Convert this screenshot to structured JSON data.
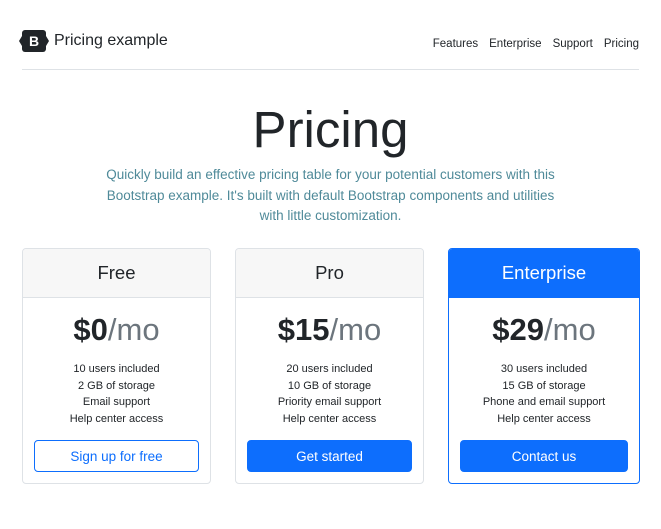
{
  "header": {
    "brand_letter": "B",
    "brand_name": "Pricing example",
    "nav": [
      "Features",
      "Enterprise",
      "Support",
      "Pricing"
    ]
  },
  "hero": {
    "title": "Pricing",
    "lead": "Quickly build an effective pricing table for your potential customers with this Bootstrap example. It's built with default Bootstrap components and utilities with little customization."
  },
  "plans": [
    {
      "name": "Free",
      "price": "$0",
      "period": "/mo",
      "features": [
        "10 users included",
        "2 GB of storage",
        "Email support",
        "Help center access"
      ],
      "button": "Sign up for free"
    },
    {
      "name": "Pro",
      "price": "$15",
      "period": "/mo",
      "features": [
        "20 users included",
        "10 GB of storage",
        "Priority email support",
        "Help center access"
      ],
      "button": "Get started"
    },
    {
      "name": "Enterprise",
      "price": "$29",
      "period": "/mo",
      "features": [
        "30 users included",
        "15 GB of storage",
        "Phone and email support",
        "Help center access"
      ],
      "button": "Contact us"
    }
  ],
  "colors": {
    "accent": "#0d6efd",
    "lead_text": "#4f8a99",
    "muted": "#6c757d"
  }
}
